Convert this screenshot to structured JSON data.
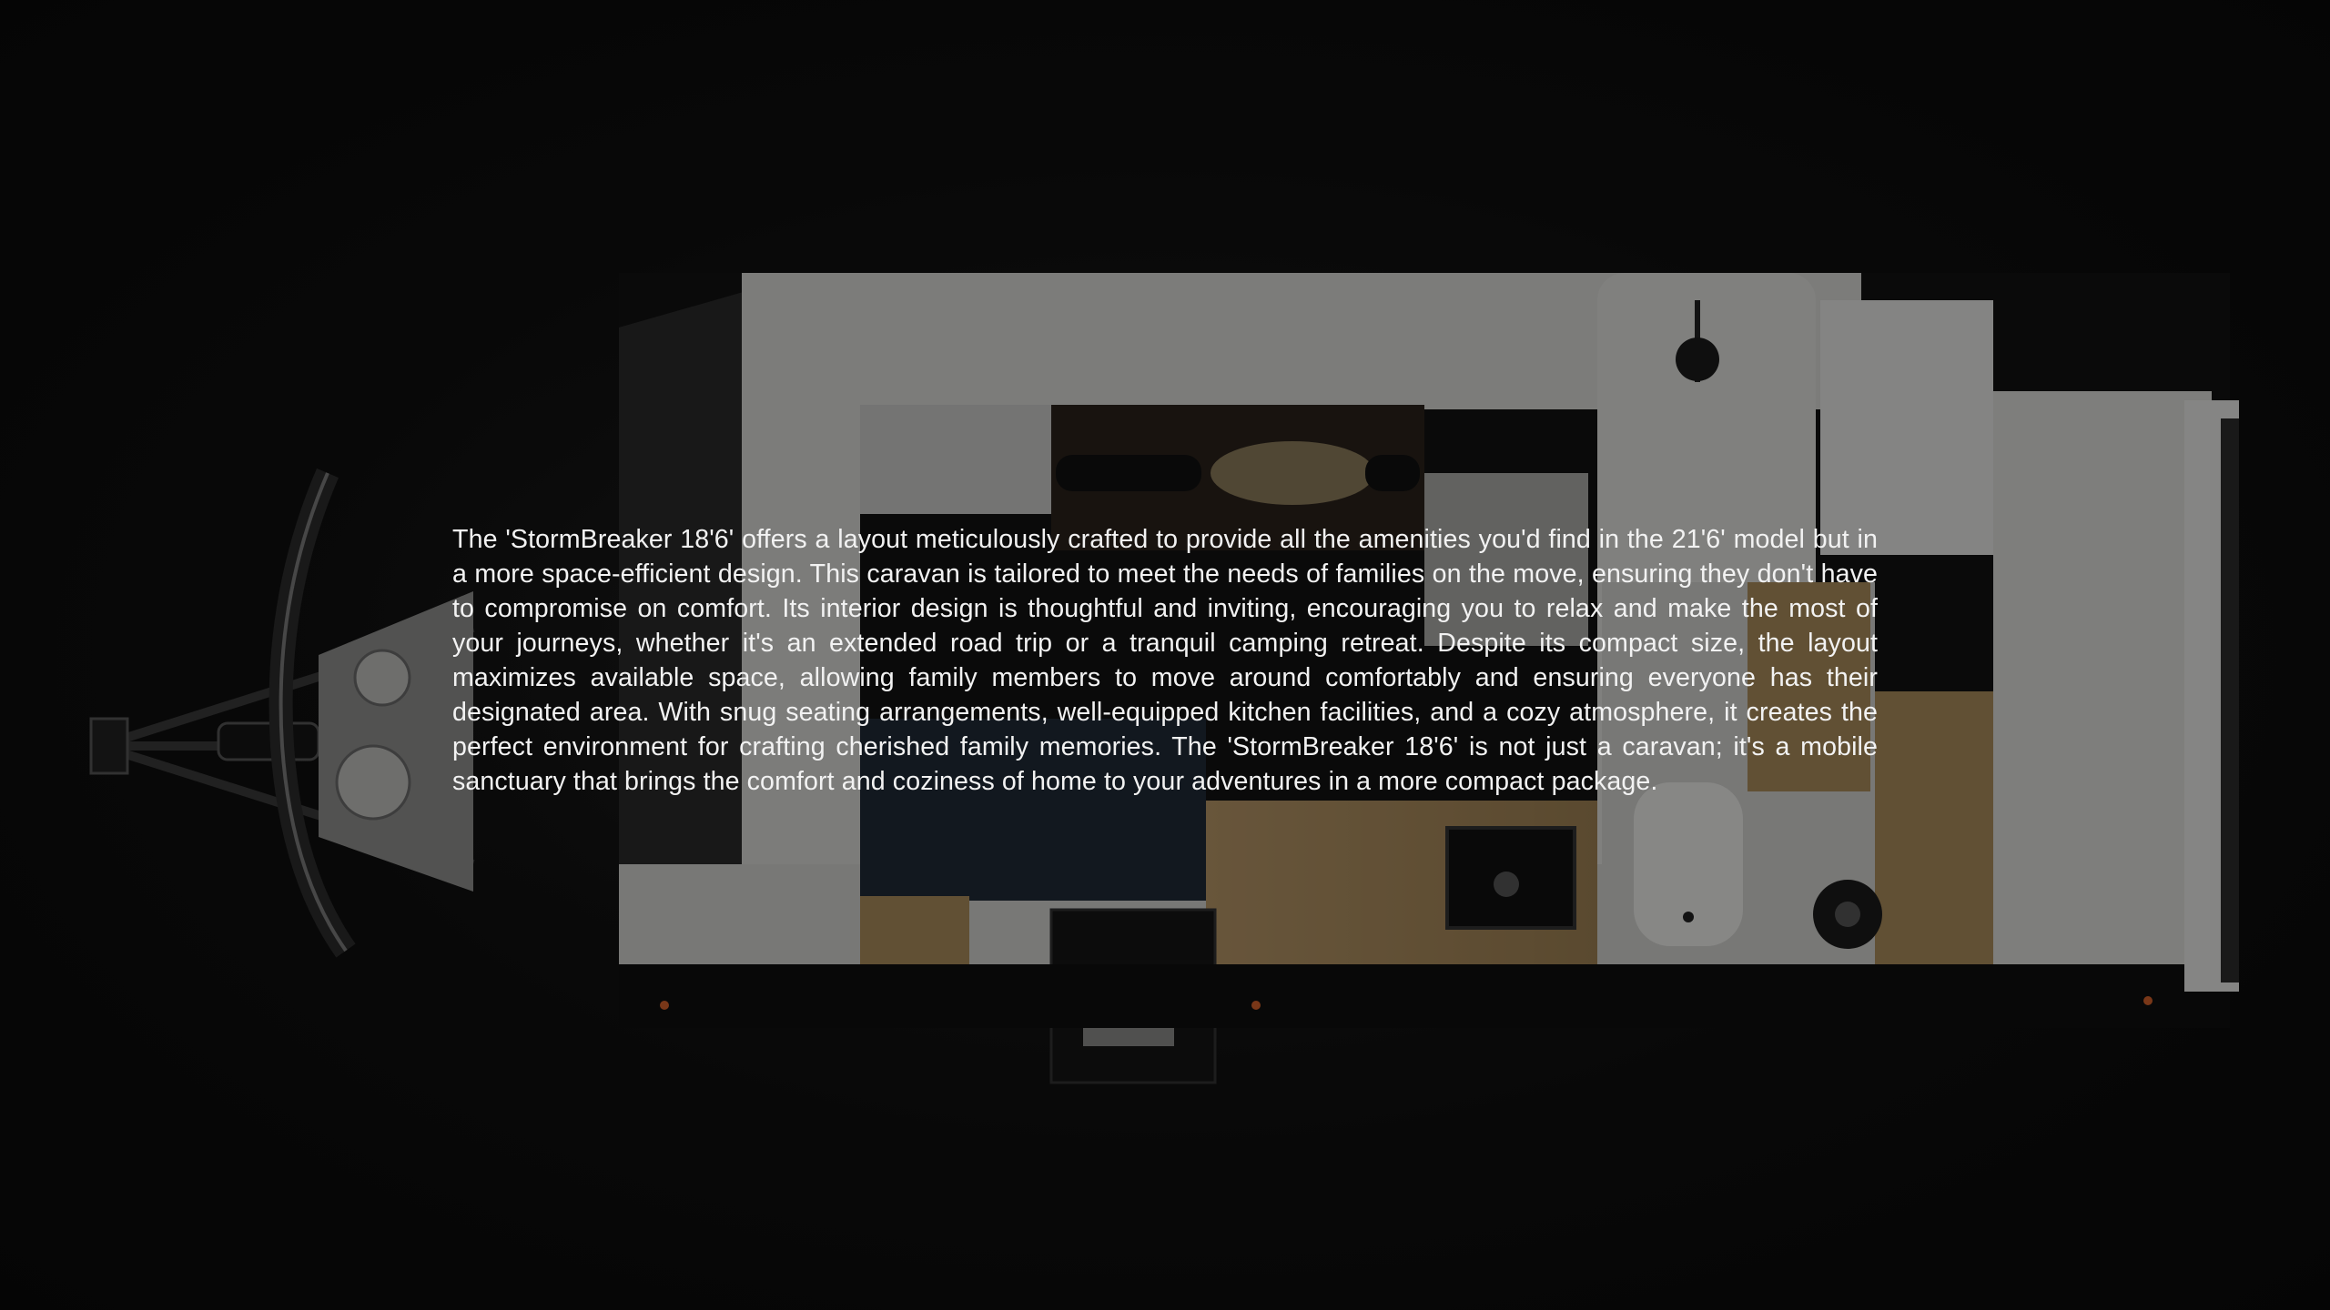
{
  "description": "The 'StormBreaker 18'6' offers a layout meticulously crafted to provide all the amenities you'd find in the 21'6' model but in a more space-efficient design. This caravan is tailored to meet the needs of families on the move, ensuring they don't have to compromise on comfort. Its interior design is thoughtful and inviting, encouraging you to relax and make the most of your journeys, whether it's an extended road trip or a tranquil camping retreat. Despite its compact size, the layout maximizes available space, allowing family members to move around comfortably and ensuring everyone has their designated area. With snug seating arrangements, well-equipped kitchen facilities, and a cozy atmosphere, it creates the perfect environment for crafting cherished family memories. The 'StormBreaker 18'6' is not just a caravan; it's a mobile sanctuary that brings the comfort and coziness of home to your adventures in a more compact package.",
  "floorplan": {
    "icon": "caravan-floorplan-image"
  },
  "colors": {
    "background": "#0d0d0d",
    "text": "#f2f2f2",
    "wall": "#d9d9d6",
    "wood": "#a88a5a",
    "sofa": "#1f2a36"
  }
}
